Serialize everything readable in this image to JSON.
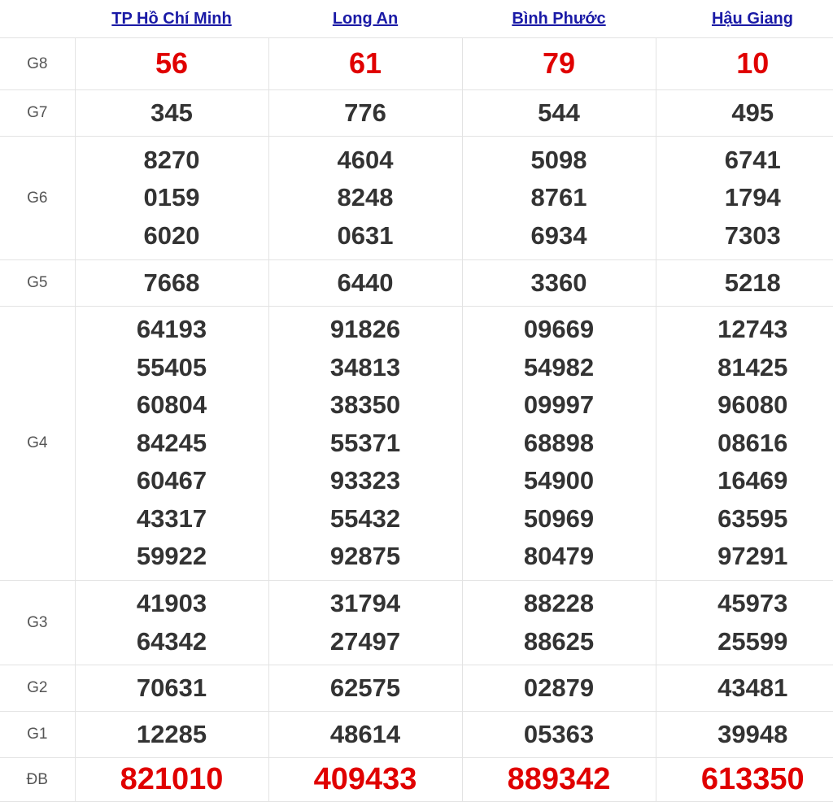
{
  "provinces": [
    "TP Hồ Chí Minh",
    "Long An",
    "Bình Phước",
    "Hậu Giang"
  ],
  "prizes": {
    "G8": {
      "label": "G8",
      "values": [
        [
          "56"
        ],
        [
          "61"
        ],
        [
          "79"
        ],
        [
          "10"
        ]
      ]
    },
    "G7": {
      "label": "G7",
      "values": [
        [
          "345"
        ],
        [
          "776"
        ],
        [
          "544"
        ],
        [
          "495"
        ]
      ]
    },
    "G6": {
      "label": "G6",
      "values": [
        [
          "8270",
          "0159",
          "6020"
        ],
        [
          "4604",
          "8248",
          "0631"
        ],
        [
          "5098",
          "8761",
          "6934"
        ],
        [
          "6741",
          "1794",
          "7303"
        ]
      ]
    },
    "G5": {
      "label": "G5",
      "values": [
        [
          "7668"
        ],
        [
          "6440"
        ],
        [
          "3360"
        ],
        [
          "5218"
        ]
      ]
    },
    "G4": {
      "label": "G4",
      "values": [
        [
          "64193",
          "55405",
          "60804",
          "84245",
          "60467",
          "43317",
          "59922"
        ],
        [
          "91826",
          "34813",
          "38350",
          "55371",
          "93323",
          "55432",
          "92875"
        ],
        [
          "09669",
          "54982",
          "09997",
          "68898",
          "54900",
          "50969",
          "80479"
        ],
        [
          "12743",
          "81425",
          "96080",
          "08616",
          "16469",
          "63595",
          "97291"
        ]
      ]
    },
    "G3": {
      "label": "G3",
      "values": [
        [
          "41903",
          "64342"
        ],
        [
          "31794",
          "27497"
        ],
        [
          "88228",
          "88625"
        ],
        [
          "45973",
          "25599"
        ]
      ]
    },
    "G2": {
      "label": "G2",
      "values": [
        [
          "70631"
        ],
        [
          "62575"
        ],
        [
          "02879"
        ],
        [
          "43481"
        ]
      ]
    },
    "G1": {
      "label": "G1",
      "values": [
        [
          "12285"
        ],
        [
          "48614"
        ],
        [
          "05363"
        ],
        [
          "39948"
        ]
      ]
    },
    "DB": {
      "label": "ĐB",
      "values": [
        [
          "821010"
        ],
        [
          "409433"
        ],
        [
          "889342"
        ],
        [
          "613350"
        ]
      ]
    }
  },
  "colors": {
    "header_link": "#1a1aa6",
    "highlight": "#e00000",
    "number": "#333333",
    "label": "#555555"
  }
}
